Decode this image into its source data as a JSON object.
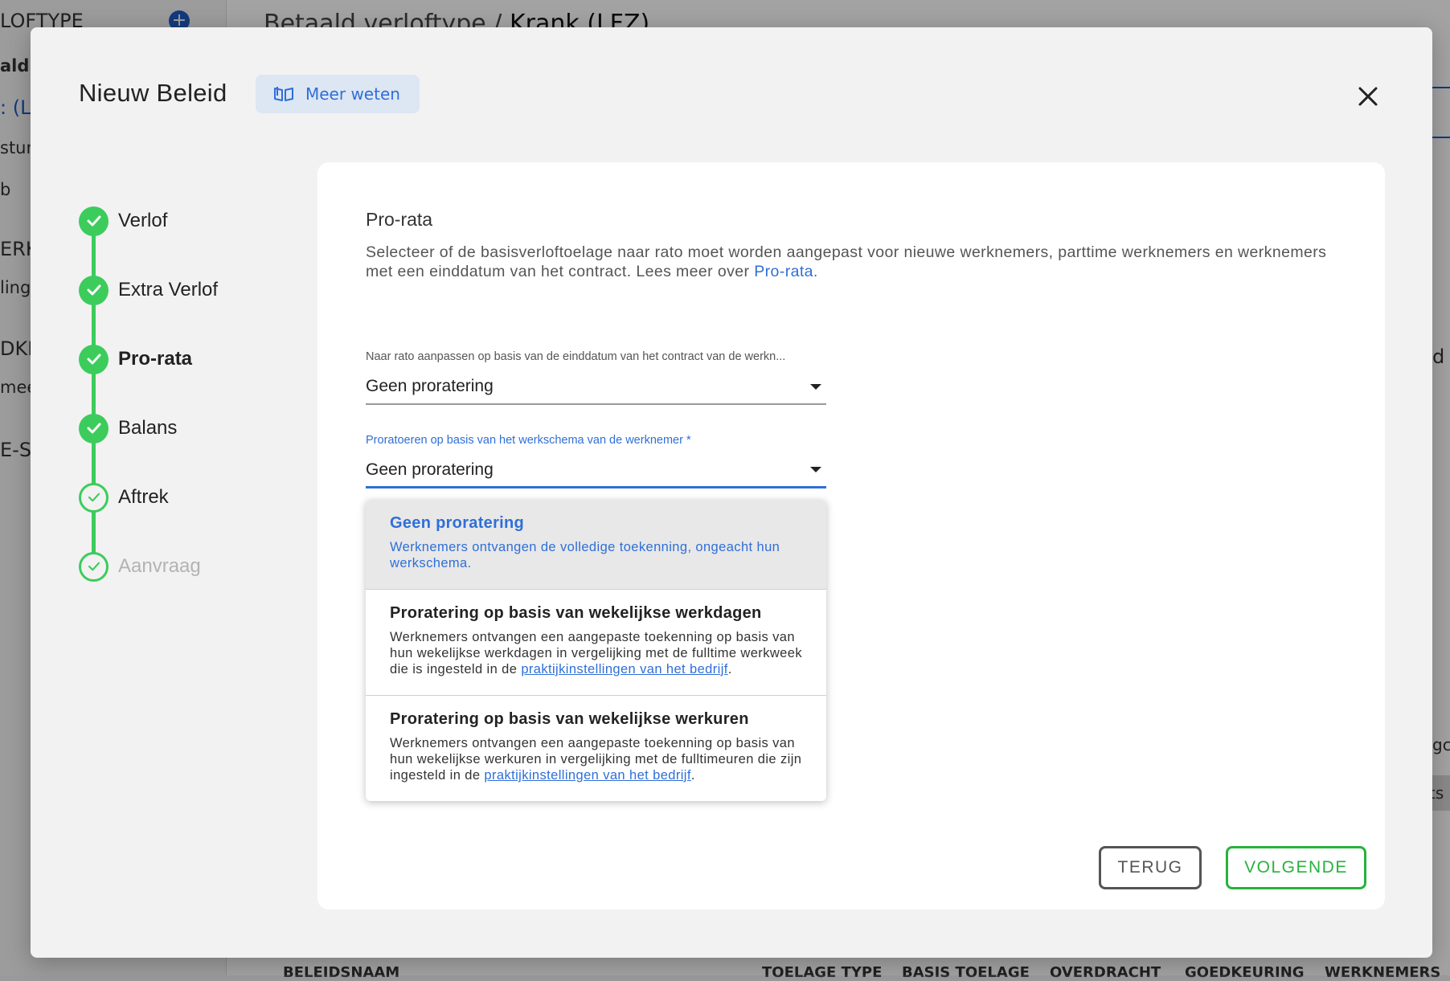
{
  "background": {
    "sidebar_title": "LOFTYPE",
    "sidebar_items": [
      "ald",
      ": (LF",
      "stun",
      "b",
      "ERK",
      "ling",
      "DKE",
      "meer",
      "E-S"
    ],
    "header_prefix": "Betaald verloftype / ",
    "header_current": "Krank (LFZ)",
    "right_edge_texts": [
      "d",
      "gc",
      "ts"
    ],
    "table_headers": [
      "BELEIDSNAAM",
      "TOELAGE TYPE",
      "BASIS TOELAGE",
      "OVERDRACHT",
      "GOEDKEURING",
      "WERKNEMERS"
    ]
  },
  "modal": {
    "title": "Nieuw Beleid",
    "learn_more_label": "Meer weten",
    "close_icon": "close-icon"
  },
  "stepper": {
    "steps": [
      {
        "label": "Verlof",
        "state": "done"
      },
      {
        "label": "Extra Verlof",
        "state": "done"
      },
      {
        "label": "Pro-rata",
        "state": "active"
      },
      {
        "label": "Balans",
        "state": "done"
      },
      {
        "label": "Aftrek",
        "state": "pending"
      },
      {
        "label": "Aanvraag",
        "state": "pending-muted"
      }
    ]
  },
  "content": {
    "section_title": "Pro-rata",
    "description": "Selecteer of de basisverloftoelage naar rato moet worden aangepast voor nieuwe werknemers, parttime werknemers en werknemers met een einddatum van het contract. Lees meer over ",
    "description_link": "Pro-rata.",
    "field1": {
      "label": "Naar rato aanpassen op basis van de einddatum van het contract van de werkn...",
      "value": "Geen proratering"
    },
    "field2": {
      "label": "Proratoeren op basis van het werkschema van de werknemer *",
      "value": "Geen proratering"
    },
    "options": [
      {
        "title": "Geen proratering",
        "desc": "Werknemers ontvangen de volledige toekenning, ongeacht hun werkschema.",
        "selected": true
      },
      {
        "title": "Proratering op basis van wekelijkse werkdagen",
        "desc": "Werknemers ontvangen een aangepaste toekenning op basis van hun wekelijkse werkdagen in vergelijking met de fulltime werkweek die is ingesteld in de ",
        "link": "praktijkinstellingen van het bedrijf",
        "tail": "."
      },
      {
        "title": "Proratering op basis van wekelijkse werkuren",
        "desc": "Werknemers ontvangen een aangepaste toekenning op basis van hun wekelijkse werkuren in vergelijking met de fulltimeuren die zijn ingesteld in de ",
        "link": "praktijkinstellingen van het bedrijf",
        "tail": "."
      }
    ]
  },
  "footer": {
    "back_label": "TERUG",
    "next_label": "VOLGENDE"
  },
  "colors": {
    "accent": "#2f6fd8",
    "success": "#3ccc5c",
    "next_button": "#27b23d"
  }
}
